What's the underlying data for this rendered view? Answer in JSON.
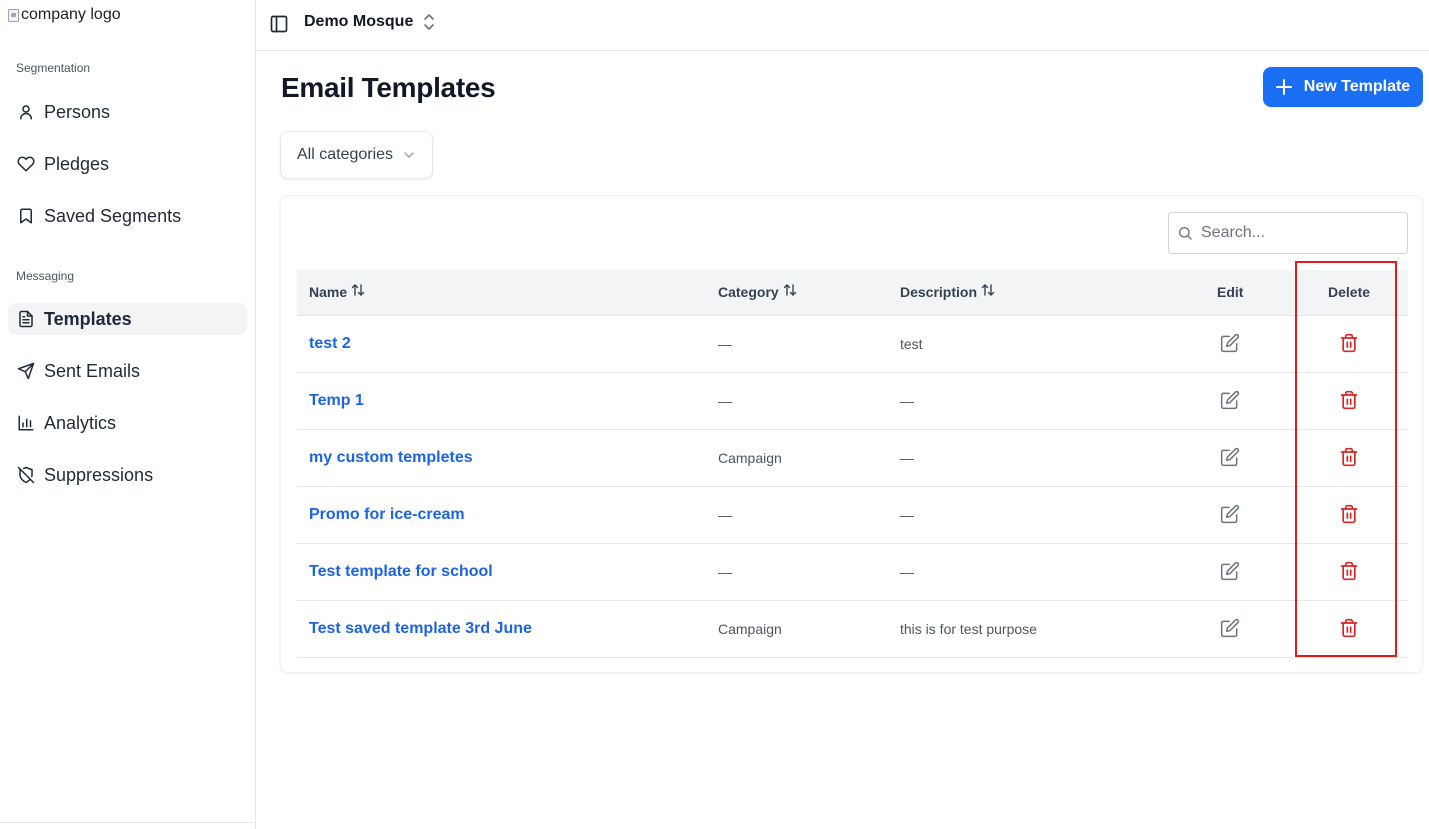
{
  "sidebar": {
    "logo_alt": "company logo",
    "sections": [
      {
        "label": "Segmentation"
      },
      {
        "label": "Messaging"
      }
    ],
    "items": [
      {
        "label": "Persons",
        "icon": "user-icon"
      },
      {
        "label": "Pledges",
        "icon": "heart-icon"
      },
      {
        "label": "Saved Segments",
        "icon": "bookmark-icon"
      },
      {
        "label": "Templates",
        "icon": "file-text-icon",
        "active": true
      },
      {
        "label": "Sent Emails",
        "icon": "send-icon"
      },
      {
        "label": "Analytics",
        "icon": "bar-chart-icon"
      },
      {
        "label": "Suppressions",
        "icon": "shield-off-icon"
      }
    ]
  },
  "header": {
    "org_name": "Demo Mosque"
  },
  "main": {
    "title": "Email Templates",
    "new_button_label": "New Template",
    "category_filter": "All categories",
    "search_placeholder": "Search...",
    "columns": {
      "name": "Name",
      "category": "Category",
      "description": "Description",
      "edit": "Edit",
      "delete": "Delete"
    },
    "rows": [
      {
        "name": "test 2",
        "category": "—",
        "description": "test"
      },
      {
        "name": "Temp 1",
        "category": "—",
        "description": "—"
      },
      {
        "name": "my custom templetes",
        "category": "Campaign",
        "description": "—"
      },
      {
        "name": "Promo for ice-cream",
        "category": "—",
        "description": "—"
      },
      {
        "name": "Test template for school",
        "category": "—",
        "description": "—"
      },
      {
        "name": "Test saved template 3rd June",
        "category": "Campaign",
        "description": "this is for test purpose"
      }
    ]
  },
  "colors": {
    "primary": "#1a6ff4",
    "link": "#1d64e0",
    "delete": "#dc2626",
    "highlight": "#e01b1b"
  }
}
